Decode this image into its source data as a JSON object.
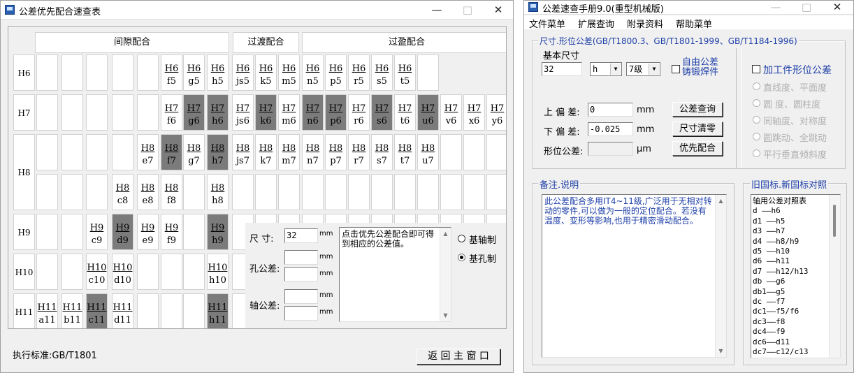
{
  "left_window": {
    "title": "公差优先配合速查表",
    "group_headers": [
      "间隙配合",
      "过渡配合",
      "过盈配合"
    ],
    "row_labels": [
      "H6",
      "H7",
      "H8",
      "H9",
      "H10",
      "H11"
    ],
    "standard_label": "执行标准:GB/T1801",
    "back_button": "返 回 主 窗 口",
    "calc": {
      "size_label": "尺  寸:",
      "size_value": "32",
      "unit": "mm",
      "hole_label": "孔公差:",
      "shaft_label": "轴公差:",
      "note": "  点击优先公差配合即可得到相应的公差值。",
      "radio_shaft": "基轴制",
      "radio_hole": "基孔制"
    },
    "fits": [
      {
        "n": "H6",
        "d": "f5",
        "g": false
      },
      {
        "n": "H6",
        "d": "g5",
        "g": false
      },
      {
        "n": "H6",
        "d": "h5",
        "g": false
      },
      {
        "n": "H6",
        "d": "js5",
        "g": false
      },
      {
        "n": "H6",
        "d": "k5",
        "g": false
      },
      {
        "n": "H6",
        "d": "m5",
        "g": false
      },
      {
        "n": "H6",
        "d": "n5",
        "g": false
      },
      {
        "n": "H6",
        "d": "p5",
        "g": false
      },
      {
        "n": "H6",
        "d": "r5",
        "g": false
      },
      {
        "n": "H6",
        "d": "s5",
        "g": false
      },
      {
        "n": "H6",
        "d": "t5",
        "g": false
      },
      {
        "n": "H7",
        "d": "f6",
        "g": false
      },
      {
        "n": "H7",
        "d": "g6",
        "g": true
      },
      {
        "n": "H7",
        "d": "h6",
        "g": true
      },
      {
        "n": "H7",
        "d": "js6",
        "g": false
      },
      {
        "n": "H7",
        "d": "k6",
        "g": true
      },
      {
        "n": "H7",
        "d": "m6",
        "g": false
      },
      {
        "n": "H7",
        "d": "n6",
        "g": true
      },
      {
        "n": "H7",
        "d": "p6",
        "g": true
      },
      {
        "n": "H7",
        "d": "r6",
        "g": false
      },
      {
        "n": "H7",
        "d": "s6",
        "g": true
      },
      {
        "n": "H7",
        "d": "t6",
        "g": false
      },
      {
        "n": "H7",
        "d": "u6",
        "g": true
      },
      {
        "n": "H7",
        "d": "v6",
        "g": false
      },
      {
        "n": "H7",
        "d": "x6",
        "g": false
      },
      {
        "n": "H7",
        "d": "y6",
        "g": false
      },
      {
        "n": "H8",
        "d": "e7",
        "g": false
      },
      {
        "n": "H8",
        "d": "f7",
        "g": true
      },
      {
        "n": "H8",
        "d": "g7",
        "g": false
      },
      {
        "n": "H8",
        "d": "h7",
        "g": true
      },
      {
        "n": "H8",
        "d": "js7",
        "g": false
      },
      {
        "n": "H8",
        "d": "k7",
        "g": false
      },
      {
        "n": "H8",
        "d": "m7",
        "g": false
      },
      {
        "n": "H8",
        "d": "n7",
        "g": false
      },
      {
        "n": "H8",
        "d": "p7",
        "g": false
      },
      {
        "n": "H8",
        "d": "r7",
        "g": false
      },
      {
        "n": "H8",
        "d": "s7",
        "g": false
      },
      {
        "n": "H8",
        "d": "t7",
        "g": false
      },
      {
        "n": "H8",
        "d": "u7",
        "g": false
      },
      {
        "n": "H8",
        "d": "c8",
        "g": false
      },
      {
        "n": "H8",
        "d": "e8",
        "g": false
      },
      {
        "n": "H8",
        "d": "f8",
        "g": false
      },
      {
        "n": "H8",
        "d": "h8",
        "g": false
      },
      {
        "n": "H9",
        "d": "c9",
        "g": false
      },
      {
        "n": "H9",
        "d": "d9",
        "g": true
      },
      {
        "n": "H9",
        "d": "e9",
        "g": false
      },
      {
        "n": "H9",
        "d": "f9",
        "g": false
      },
      {
        "n": "H9",
        "d": "h9",
        "g": true
      },
      {
        "n": "H10",
        "d": "c10",
        "g": false
      },
      {
        "n": "H10",
        "d": "d10",
        "g": false
      },
      {
        "n": "H10",
        "d": "h10",
        "g": false
      },
      {
        "n": "H11",
        "d": "a11",
        "g": false
      },
      {
        "n": "H11",
        "d": "b11",
        "g": false
      },
      {
        "n": "H11",
        "d": "c11",
        "g": true
      },
      {
        "n": "H11",
        "d": "d11",
        "g": false
      },
      {
        "n": "H11",
        "d": "h11",
        "g": true
      }
    ]
  },
  "right_window": {
    "title": "公差速查手册9.0(重型机械版)",
    "menu": [
      "文件菜单",
      "扩展查询",
      "附录资料",
      "帮助菜单"
    ],
    "section_legend": "尺寸.形位公差(GB/T1800.3、GB/T1801-1999、GB/T1184-1996)",
    "basic_size_label": "基本尺寸",
    "basic_size_value": "32",
    "fit_letter": "h",
    "grade": "7级",
    "free_tol_label": "自由公差\n铸锻焊件",
    "upper_label": "上 偏 差:",
    "upper_value": "0",
    "lower_label": "下 偏 差:",
    "lower_value": "-0.025",
    "form_label": "形位公差:",
    "unit_mm": "mm",
    "unit_um": "µm",
    "btn_query": "公差查询",
    "btn_clear": "尺寸清零",
    "btn_pref": "优先配合",
    "machined_label": "加工件形位公差",
    "radio_options": [
      "直线度、平面度",
      "圆  度、圆柱度",
      "同轴度、对称度",
      "圆跳动、全跳动",
      "平行垂直倾斜度"
    ],
    "remarks_legend": "备注.说明",
    "remarks_text": "    此公差配合多用IT4~11级,广泛用于无相对转动的零件,可以做为一般的定位配合。若没有温度、变形等影响,也用于精密滑动配合。",
    "std_legend": "旧国标.新国标对照",
    "std_lines": [
      "轴用公差对照表",
      "d  ——h6",
      "d1 ——h5",
      "d3 ——h7",
      "d4 ——h8/h9",
      "d5 ——h10",
      "d6 ——h11",
      "d7 ——h12/h13",
      "db ——g6",
      "db1——g5",
      "dc ——f7",
      "dc1——f5/f6",
      "dc3——f8",
      "dc4——f9",
      "dc6——d11",
      "dc7——c12/c13"
    ]
  }
}
